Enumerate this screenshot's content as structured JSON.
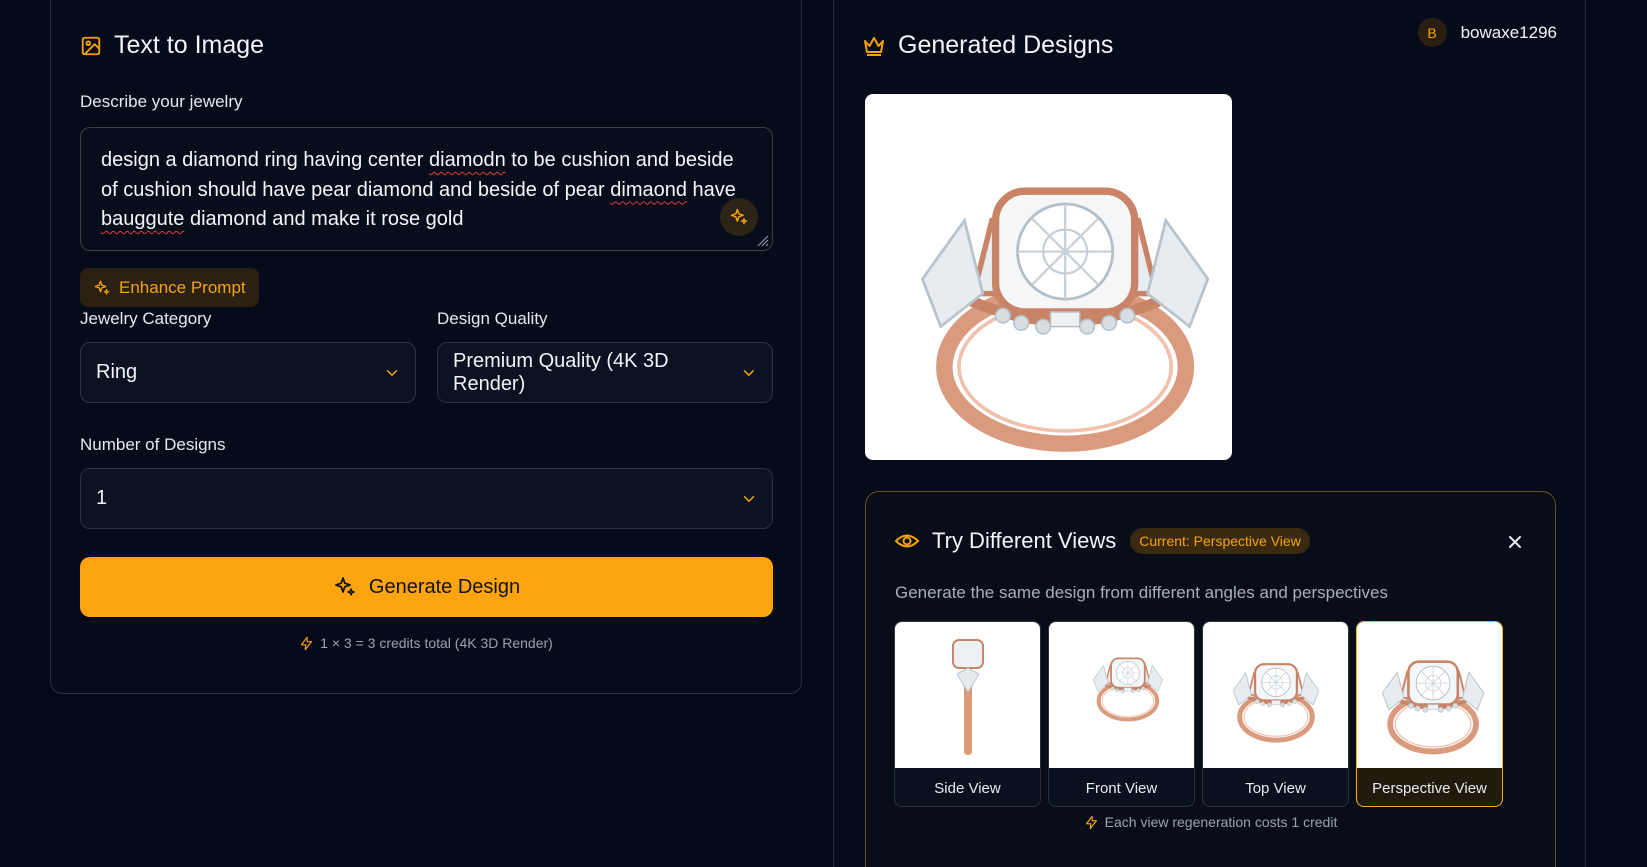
{
  "left": {
    "title": "Text to Image",
    "describe_label": "Describe your jewelry",
    "prompt": {
      "part1": "design a diamond ring having center ",
      "typo1": "diamodn",
      "part2": " to be cushion and beside of cushion should have pear diamond and beside of pear ",
      "typo2": "dimaond",
      "part3": " have ",
      "typo3": "bauggute",
      "part4": " diamond and make it rose gold"
    },
    "enhance_label": "Enhance Prompt",
    "category_label": "Jewelry Category",
    "category_value": "Ring",
    "quality_label": "Design Quality",
    "quality_value": "Premium Quality (4K 3D Render)",
    "count_label": "Number of Designs",
    "count_value": "1",
    "generate_label": "Generate Design",
    "credits_text": "1 × 3 = 3 credits total (4K 3D Render)"
  },
  "right": {
    "title": "Generated Designs",
    "user": {
      "initial": "B",
      "name": "bowaxe1296"
    },
    "views": {
      "title": "Try Different Views",
      "current_badge": "Current: Perspective View",
      "subtitle": "Generate the same design from different angles and perspectives",
      "options": [
        {
          "label": "Side View"
        },
        {
          "label": "Front View"
        },
        {
          "label": "Top View"
        },
        {
          "label": "Perspective View"
        }
      ],
      "note": "Each view regeneration costs 1 credit"
    }
  },
  "colors": {
    "accent": "#fea40e",
    "background": "#020815",
    "panel": "#050b18",
    "rose_gold": "#d99a7e"
  }
}
